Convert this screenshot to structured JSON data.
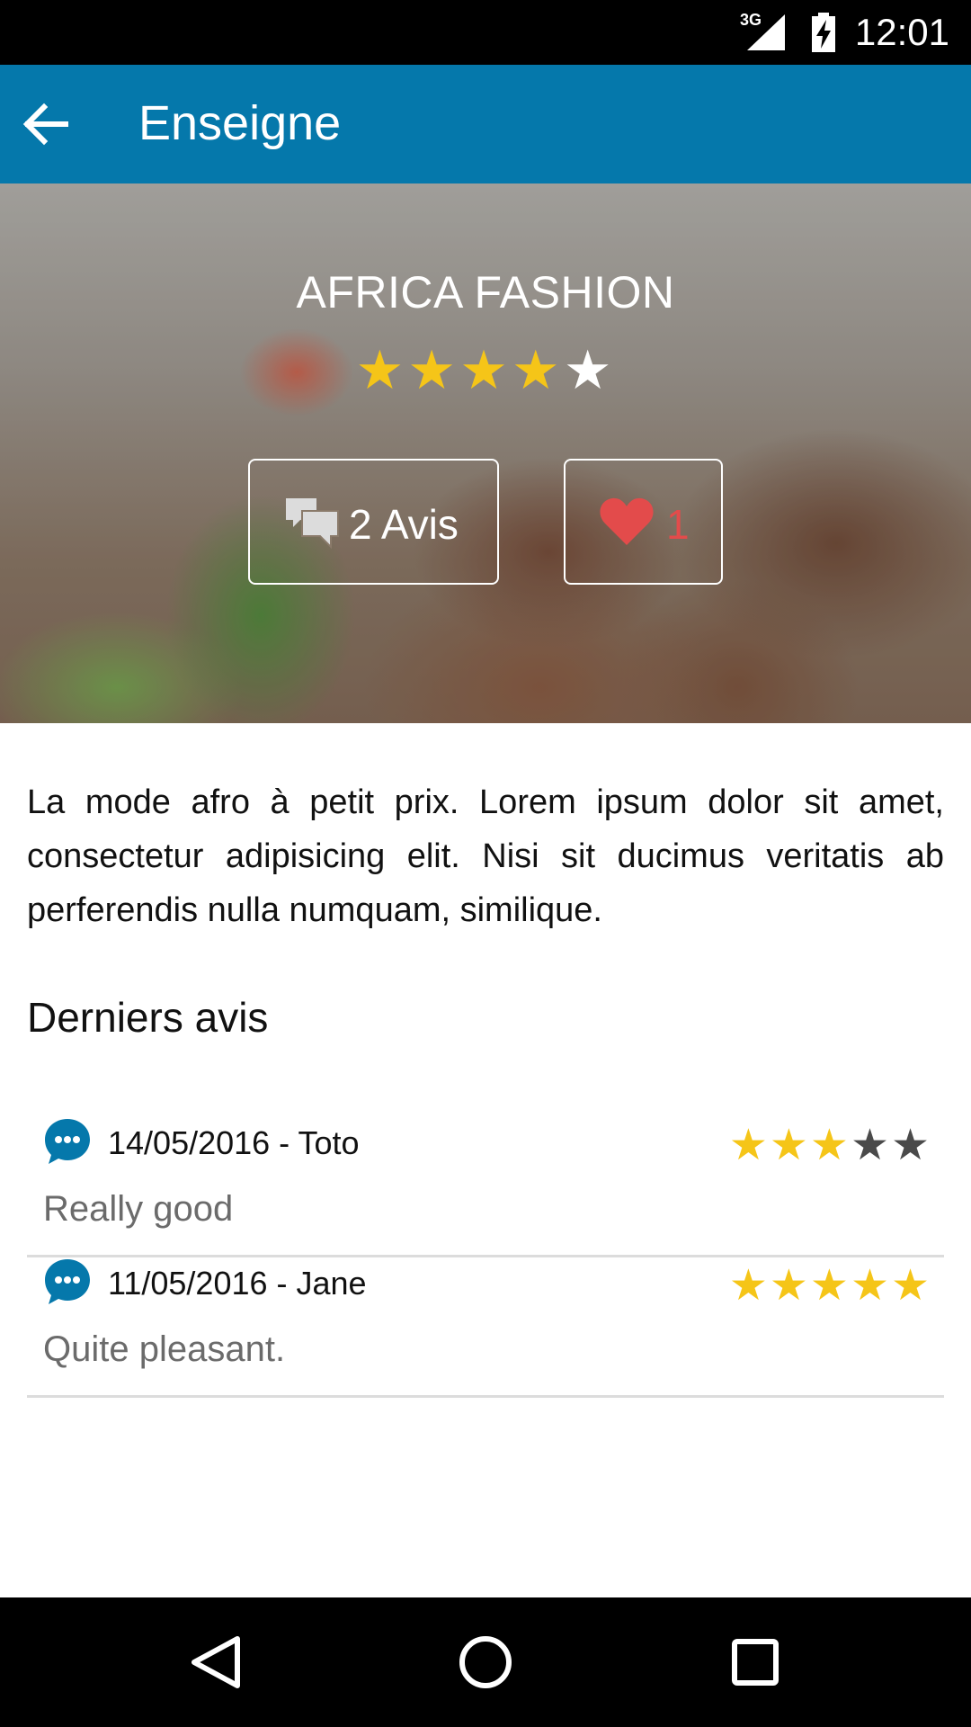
{
  "status_bar": {
    "network": "3G",
    "time": "12:01"
  },
  "app_bar": {
    "title": "Enseigne"
  },
  "store": {
    "name": "AFRICA FASHION",
    "rating": 4,
    "rating_max": 5,
    "reviews_button_label": "2 Avis",
    "likes_count": "1",
    "description": "La mode afro à petit prix. Lorem ipsum dolor sit amet, consectetur adipisicing elit. Nisi sit ducimus veritatis ab perferendis nulla numquam, similique."
  },
  "reviews_section": {
    "title": "Derniers avis",
    "items": [
      {
        "meta": "14/05/2016 - Toto",
        "rating": 3,
        "rating_max": 5,
        "text": "Really good"
      },
      {
        "meta": "11/05/2016 - Jane",
        "rating": 5,
        "rating_max": 5,
        "text": "Quite pleasant."
      }
    ]
  },
  "colors": {
    "app_bar": "#0578ab",
    "star_active": "#f5c518",
    "heart": "#e34b4b",
    "review_icon": "#0578ab"
  },
  "icons": {
    "back": "arrow-left-icon",
    "reviews": "chat-bubbles-icon",
    "likes": "heart-icon",
    "review_item": "chat-dots-icon",
    "nav_back": "triangle-back-icon",
    "nav_home": "circle-home-icon",
    "nav_recents": "square-recents-icon"
  }
}
